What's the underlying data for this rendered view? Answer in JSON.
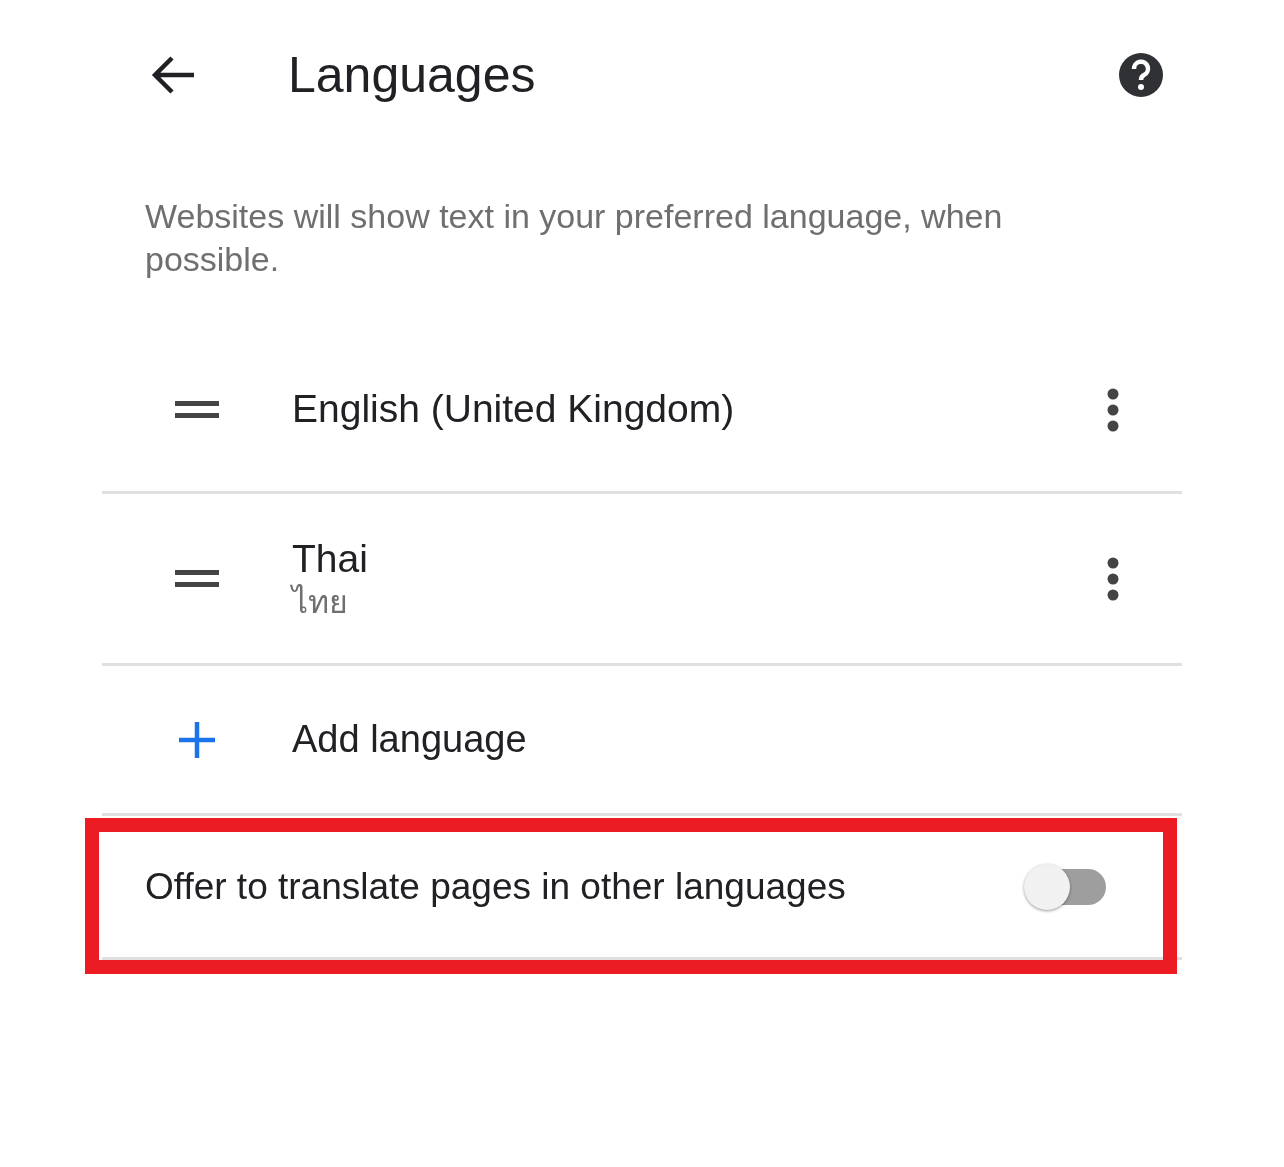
{
  "header": {
    "title": "Languages"
  },
  "description": "Websites will show text in your preferred language, when possible.",
  "languages": [
    {
      "name": "English (United Kingdom)"
    },
    {
      "name": "Thai",
      "native_name": "ไทย"
    }
  ],
  "add_language": {
    "label": "Add language"
  },
  "translate_setting": {
    "label": "Offer to translate pages in other languages",
    "on": false,
    "highlighted": true
  }
}
